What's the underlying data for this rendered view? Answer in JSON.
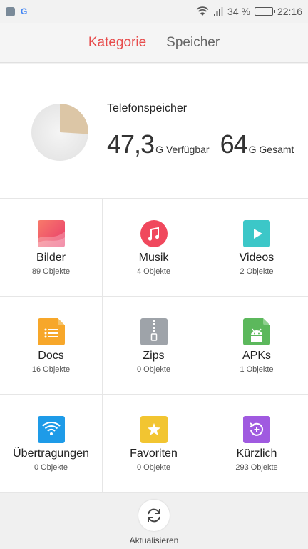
{
  "status_bar": {
    "g_label": "G",
    "battery": "34 %",
    "battery_fraction": 0.34,
    "time": "22:16"
  },
  "tabs": [
    {
      "label": "Kategorie",
      "active": true
    },
    {
      "label": "Speicher",
      "active": false
    }
  ],
  "storage": {
    "title": "Telefonspeicher",
    "available_value": "47,3",
    "available_label": "G Verfügbar",
    "total_value": "64",
    "total_label": "G Gesamt",
    "used_fraction": 0.26,
    "colors": {
      "used": "#dcc6a6",
      "free": "#ededed"
    }
  },
  "categories": [
    {
      "label": "Bilder",
      "count": "89 Objekte",
      "icon": "images-icon"
    },
    {
      "label": "Musik",
      "count": "4 Objekte",
      "icon": "music-icon"
    },
    {
      "label": "Videos",
      "count": "2 Objekte",
      "icon": "videos-icon"
    },
    {
      "label": "Docs",
      "count": "16 Objekte",
      "icon": "docs-icon"
    },
    {
      "label": "Zips",
      "count": "0 Objekte",
      "icon": "zip-icon"
    },
    {
      "label": "APKs",
      "count": "1 Objekte",
      "icon": "android-icon"
    },
    {
      "label": "Übertragungen",
      "count": "0 Objekte",
      "icon": "wifi-transfer-icon"
    },
    {
      "label": "Favoriten",
      "count": "0 Objekte",
      "icon": "star-icon"
    },
    {
      "label": "Kürzlich",
      "count": "293 Objekte",
      "icon": "recent-icon"
    }
  ],
  "bottom": {
    "refresh_label": "Aktualisieren"
  },
  "colors": {
    "accent": "#e74c4c",
    "images": "#f2506a",
    "music": "#f0485d",
    "videos": "#3cc7c8",
    "docs": "#f7a72a",
    "zips": "#9ea3a9",
    "apks": "#5cb85c",
    "transfers": "#1e9be8",
    "favorites": "#f2c531",
    "recent": "#a05ae0"
  }
}
